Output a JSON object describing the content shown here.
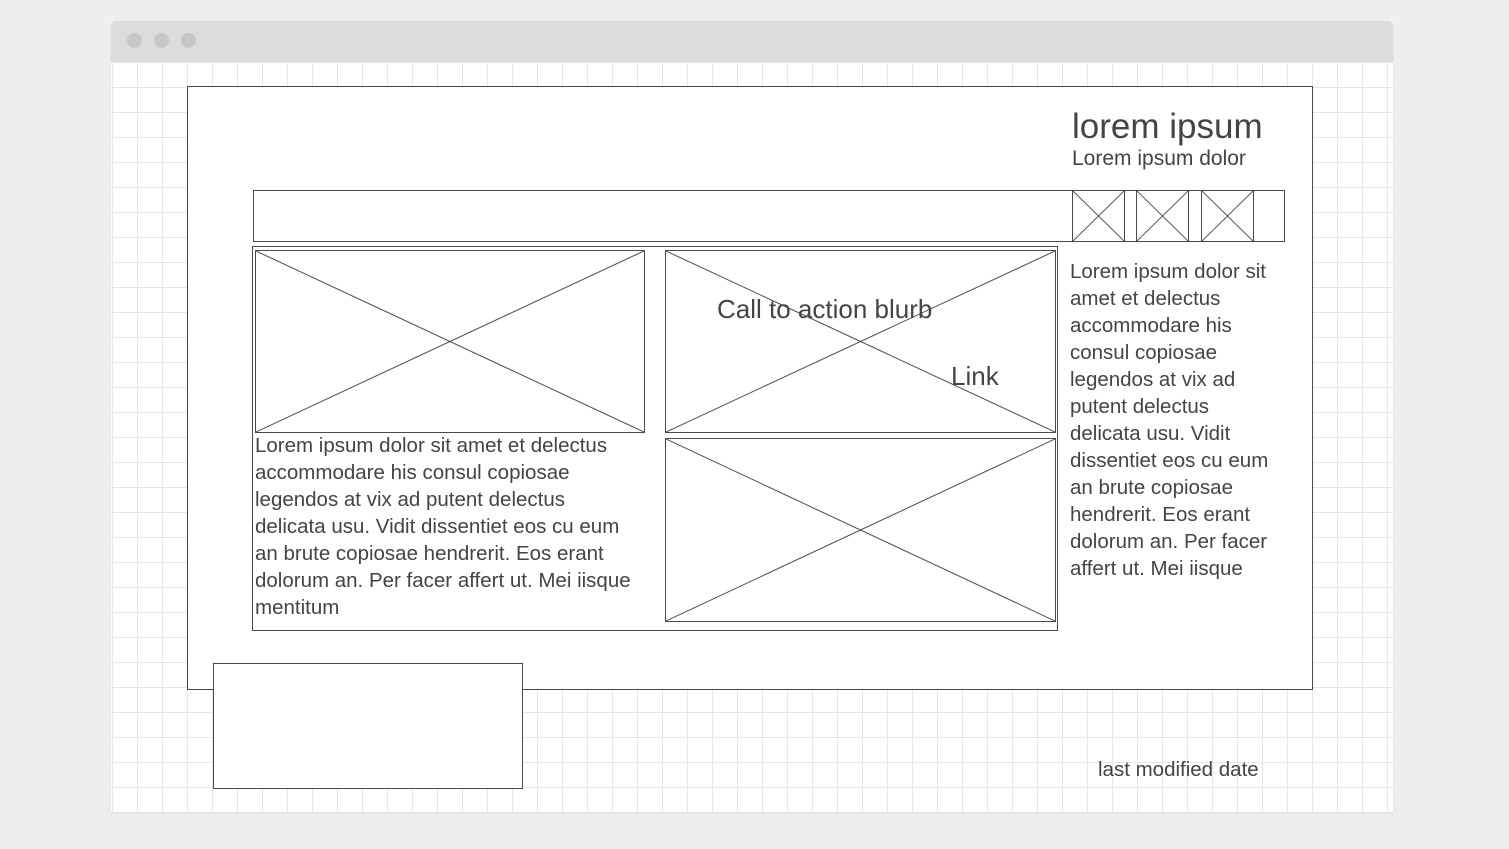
{
  "window": {
    "traffic_lights": [
      "close-dot",
      "minimize-dot",
      "maximize-dot"
    ]
  },
  "header": {
    "title": "lorem ipsum",
    "subtitle": "Lorem ipsum dolor"
  },
  "nav": {
    "icons": [
      "image-placeholder-icon",
      "image-placeholder-icon",
      "image-placeholder-icon"
    ]
  },
  "main": {
    "body_text": "Lorem ipsum dolor sit amet et delectus accommodare his consul copiosae legendos at vix ad putent delectus delicata usu. Vidit dissentiet eos cu eum an brute copiosae hendrerit. Eos erant dolorum an. Per facer affert ut. Mei iisque mentitum",
    "cta_blurb": "Call to action blurb",
    "cta_link": "Link"
  },
  "sidebar": {
    "text": "Lorem ipsum dolor sit amet et delectus accommodare his consul copiosae legendos at vix ad putent delectus delicata usu. Vidit dissentiet eos cu eum an brute copiosae hendrerit. Eos erant dolorum an. Per facer affert ut. Mei iisque"
  },
  "footer": {
    "last_modified": "last modified date"
  }
}
